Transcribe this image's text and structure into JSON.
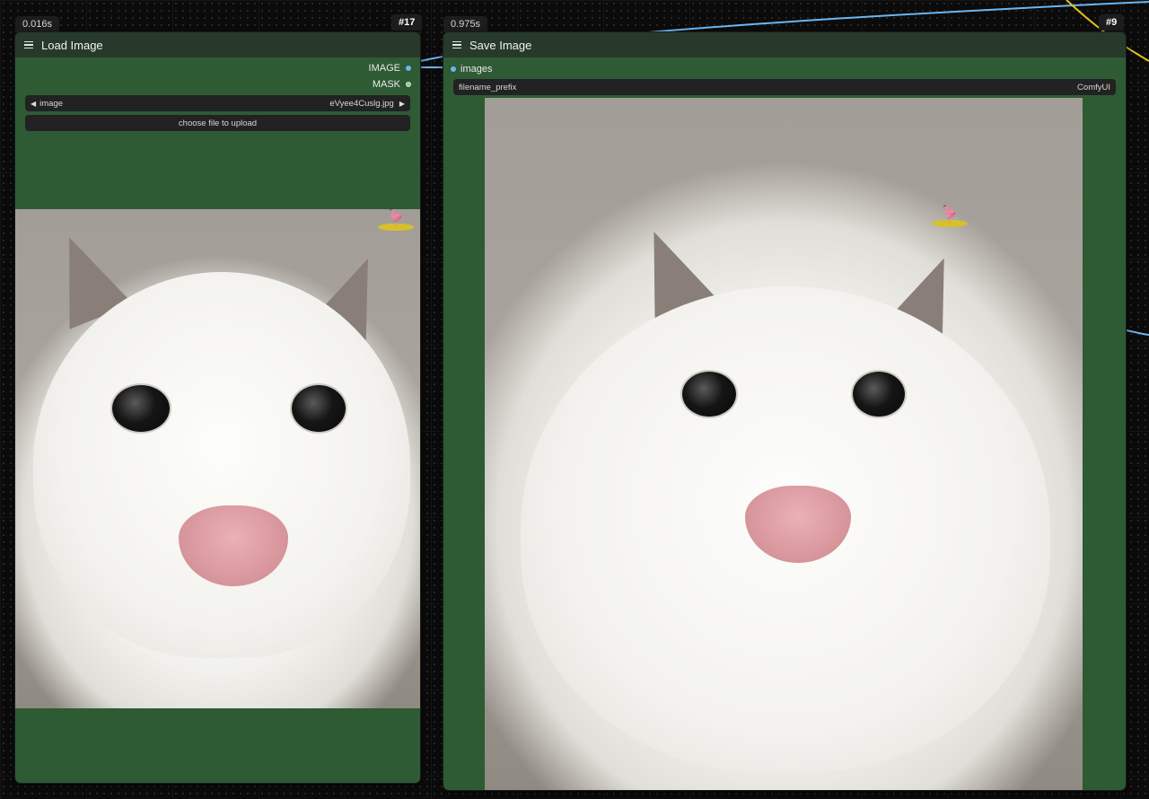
{
  "load_node": {
    "timing": "0.016s",
    "id": "#17",
    "title": "Load Image",
    "outputs": [
      "IMAGE",
      "MASK"
    ],
    "widget": {
      "label": "image",
      "value": "eVyee4Cuslg.jpg"
    },
    "upload_button": "choose file to upload",
    "preview_icon": "photo-white-cat"
  },
  "save_node": {
    "timing": "0.975s",
    "id": "#9",
    "title": "Save Image",
    "input": "images",
    "widget": {
      "label": "filename_prefix",
      "value": "ComfyUI"
    },
    "preview_icon": "photo-white-cat"
  },
  "colors": {
    "node_body": "#2e5a34",
    "node_header": "#27392b",
    "link_image": "#6bb6f1",
    "link_yellow": "#e8c21a"
  }
}
